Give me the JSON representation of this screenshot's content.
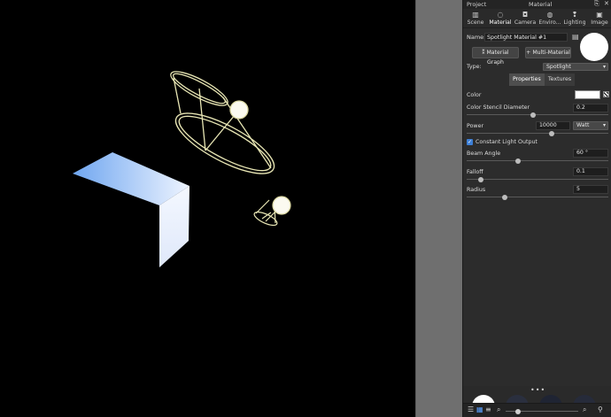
{
  "header": {
    "project_label": "Project",
    "title": "Material",
    "pin_icon": "pin-icon",
    "close_icon": "close-icon"
  },
  "tabs": [
    {
      "label": "Scene",
      "icon": "scene-icon",
      "glyph": "▥"
    },
    {
      "label": "Material",
      "icon": "material-icon",
      "glyph": "◌"
    },
    {
      "label": "Camera",
      "icon": "camera-icon",
      "glyph": "◘"
    },
    {
      "label": "Enviro...",
      "icon": "environment-icon",
      "glyph": "◍"
    },
    {
      "label": "Lighting",
      "icon": "lighting-icon",
      "glyph": "❢"
    },
    {
      "label": "Image",
      "icon": "image-icon",
      "glyph": "▣"
    }
  ],
  "active_tab": "Material",
  "material": {
    "name_label": "Name:",
    "name_value": "Spotlight Material #1",
    "save_glyph": "▤",
    "graph_button": "Material Graph",
    "graph_glyph": "⁑",
    "multi_button": "Multi-Material",
    "multi_glyph": "+",
    "type_label": "Type:",
    "type_value": "Spotlight",
    "chevron": "▾",
    "preview_color": "#ffffff"
  },
  "subtabs": {
    "properties": "Properties",
    "textures": "Textures"
  },
  "properties": {
    "color_label": "Color",
    "color_value": "#ffffff",
    "stencil_label": "Color Stencil Diameter",
    "stencil_value": "0.2",
    "stencil_frac": 0.47,
    "power_label": "Power",
    "power_value": "10000",
    "power_unit": "Watt",
    "power_frac": 0.6,
    "constant_label": "Constant Light Output",
    "check_glyph": "✓",
    "beam_label": "Beam Angle",
    "beam_value": "60 °",
    "beam_frac": 0.36,
    "falloff_label": "Falloff",
    "falloff_value": "0.1",
    "falloff_frac": 0.1,
    "radius_label": "Radius",
    "radius_value": "5",
    "radius_frac": 0.27
  },
  "bottom": {
    "more_dots": "•••",
    "toolbar_list_icon": "list-view-icon",
    "toolbar_grid_icon": "grid-view-icon",
    "toolbar_search_icon": "search-icon",
    "toolbar_zoom_icon": "zoom-icon",
    "toolbar_filter_icon": "filter-icon",
    "glyph_list": "☰",
    "glyph_grid": "▦",
    "glyph_menu": "≡",
    "glyph_search": "⌕",
    "glyph_zoom": "⌕",
    "glyph_filter": "⚲",
    "thumb_size": 0.17
  }
}
